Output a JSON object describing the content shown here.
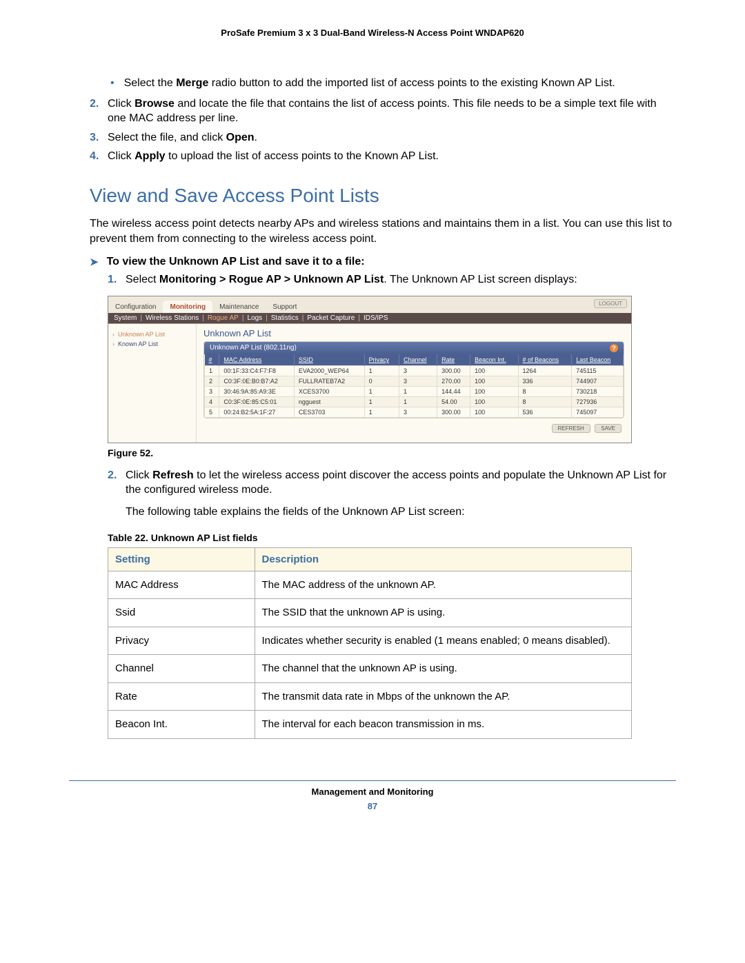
{
  "doc_title": "ProSafe Premium 3 x 3 Dual-Band Wireless-N Access Point WNDAP620",
  "bullet_merge_pre": "Select the ",
  "bullet_merge_bold": "Merge",
  "bullet_merge_post": " radio button to add the imported list of access points to the existing Known AP List.",
  "s2_pre": "Click ",
  "s2_bold": "Browse",
  "s2_post": " and locate the file that contains the list of access points. This file needs to be a simple text file with one MAC address per line.",
  "s3_pre": "Select the file, and click ",
  "s3_bold": "Open",
  "s3_post": ".",
  "s4_pre": "Click ",
  "s4_bold": "Apply",
  "s4_post": " to upload the list of access points to the Known AP List.",
  "heading": "View and Save Access Point Lists",
  "intro": "The wireless access point detects nearby APs and wireless stations and maintains them in a list. You can use this list to prevent them from connecting to the wireless access point.",
  "task": "To view the Unknown AP List and save it to a file:",
  "t1_pre": "Select ",
  "t1_bold": "Monitoring > Rogue AP > Unknown AP List",
  "t1_post": ". The Unknown AP List screen displays:",
  "shot": {
    "tabs": [
      "Configuration",
      "Monitoring",
      "Maintenance",
      "Support"
    ],
    "active_tab": "Monitoring",
    "logout": "LOGOUT",
    "sub": [
      "System",
      "Wireless Stations",
      "Rogue AP",
      "Logs",
      "Statistics",
      "Packet Capture",
      "IDS/IPS"
    ],
    "sub_active": "Rogue AP",
    "side": [
      {
        "label": "Unknown AP List",
        "cur": true
      },
      {
        "label": "Known AP List",
        "cur": false
      }
    ],
    "panel_title": "Unknown AP List",
    "group_title": "Unknown AP List (802.11ng)",
    "cols": [
      "#",
      "MAC Address",
      "SSID",
      "Privacy",
      "Channel",
      "Rate",
      "Beacon Int.",
      "# of Beacons",
      "Last Beacon"
    ],
    "rows": [
      [
        "1",
        "00:1F:33:C4:F7:F8",
        "EVA2000_WEP64",
        "1",
        "3",
        "300.00",
        "100",
        "1264",
        "745115"
      ],
      [
        "2",
        "C0:3F:0E:B0:B7:A2",
        "FULLRATEB7A2",
        "0",
        "3",
        "270.00",
        "100",
        "336",
        "744907"
      ],
      [
        "3",
        "30:46:9A:85:A9:3E",
        "XCES3700",
        "1",
        "1",
        "144.44",
        "100",
        "8",
        "730218"
      ],
      [
        "4",
        "C0:3F:0E:85:C5:01",
        "ngguest",
        "1",
        "1",
        "54.00",
        "100",
        "8",
        "727936"
      ],
      [
        "5",
        "00:24:B2:5A:1F:27",
        "CES3703",
        "1",
        "3",
        "300.00",
        "100",
        "536",
        "745097"
      ]
    ],
    "btn_refresh": "REFRESH",
    "btn_save": "SAVE"
  },
  "fig_cap": "Figure 52.",
  "t2_pre": "Click ",
  "t2_bold": "Refresh",
  "t2_post": " to let the wireless access point discover the access points and populate the Unknown AP List for the configured wireless mode.",
  "para2": "The following table explains the fields of the Unknown AP List screen:",
  "tbl_cap": "Table 22.  Unknown AP List fields",
  "th1": "Setting",
  "th2": "Description",
  "fields": [
    {
      "s": "MAC Address",
      "d": "The MAC address of the unknown AP."
    },
    {
      "s": "Ssid",
      "d": "The SSID that the unknown AP is using."
    },
    {
      "s": "Privacy",
      "d": "Indicates whether security is enabled (1 means enabled; 0 means disabled)."
    },
    {
      "s": "Channel",
      "d": "The channel that the unknown AP is using."
    },
    {
      "s": "Rate",
      "d": "The transmit data rate in Mbps of the unknown the AP."
    },
    {
      "s": "Beacon Int.",
      "d": "The interval for each beacon transmission in ms."
    }
  ],
  "footer_section": "Management and Monitoring",
  "footer_page": "87",
  "nums": {
    "n2": "2.",
    "n3": "3.",
    "n4": "4.",
    "n1": "1."
  }
}
